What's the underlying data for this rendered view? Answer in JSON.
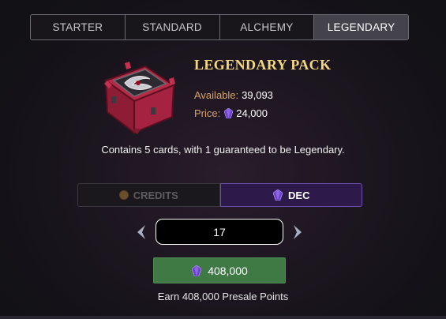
{
  "tabs": [
    {
      "label": "STARTER",
      "active": false
    },
    {
      "label": "STANDARD",
      "active": false
    },
    {
      "label": "ALCHEMY",
      "active": false
    },
    {
      "label": "LEGENDARY",
      "active": true
    }
  ],
  "pack": {
    "title": "LEGENDARY PACK",
    "available_label": "Available:",
    "available_value": "39,093",
    "price_label": "Price:",
    "price_value": "24,000",
    "price_icon": "dec-gem-icon",
    "description": "Contains 5 cards, with 1 guaranteed to be Legendary."
  },
  "currency": {
    "credits_label": "CREDITS",
    "credits_icon": "credits-coin-icon",
    "dec_label": "DEC",
    "dec_icon": "dec-gem-icon",
    "selected": "DEC"
  },
  "quantity": {
    "value": "17"
  },
  "purchase": {
    "button_label": "408,000",
    "button_icon": "dec-gem-icon",
    "earn_text": "Earn 408,000 Presale Points"
  },
  "colors": {
    "accent_gold": "#f4d77e",
    "label_orange": "#d6a46b",
    "dec_purple": "#2d1a4a",
    "buy_green": "#3f7a45",
    "active_tab": "#44434c"
  }
}
